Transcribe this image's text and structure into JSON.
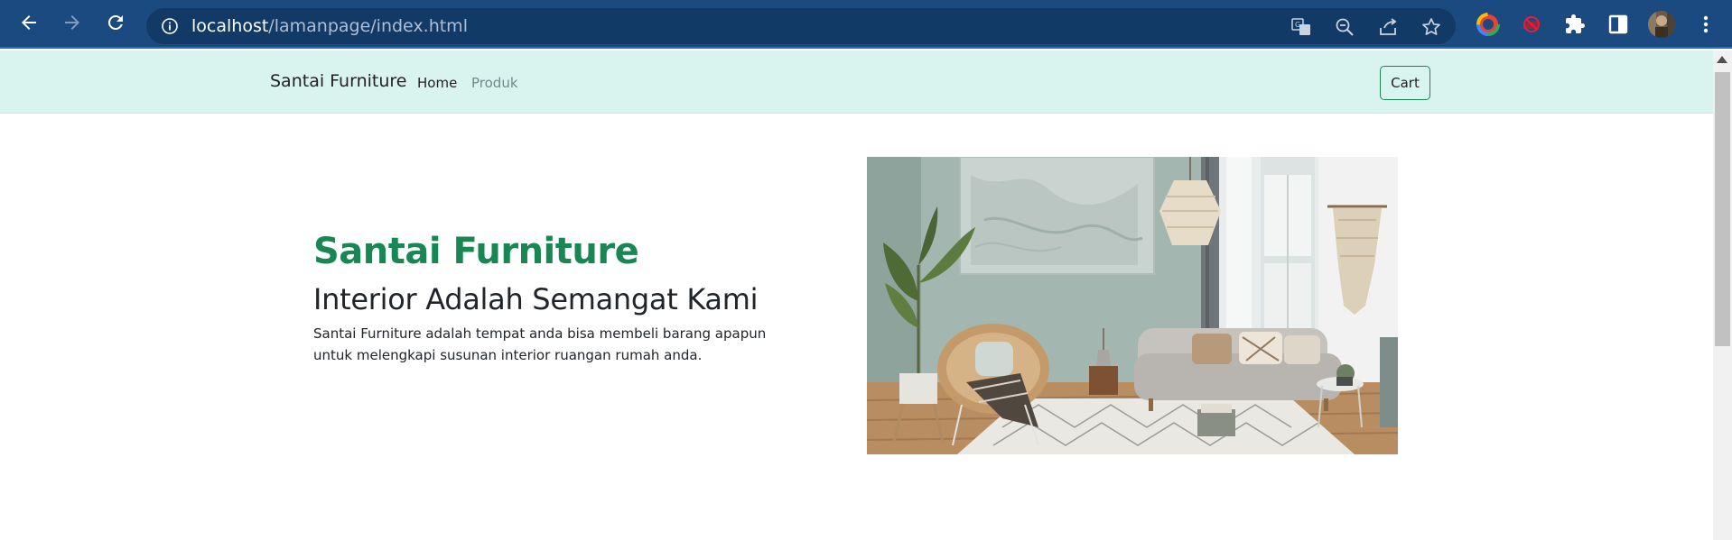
{
  "browser": {
    "url_host": "localhost",
    "url_path": "/lamanpage/index.html"
  },
  "navbar": {
    "brand": "Santai Furniture",
    "links": [
      "Home",
      "Produk"
    ],
    "cart_label": "Cart"
  },
  "hero": {
    "title": "Santai Furniture",
    "subtitle": "Interior Adalah Semangat Kami",
    "description": "Santai Furniture adalah tempat anda bisa membeli barang apapun untuk melengkapi susunan interior ruangan rumah anda."
  },
  "colors": {
    "chrome_bg": "#1b4a80",
    "navbar_bg": "#d9f3ef",
    "accent_green": "#198754"
  }
}
